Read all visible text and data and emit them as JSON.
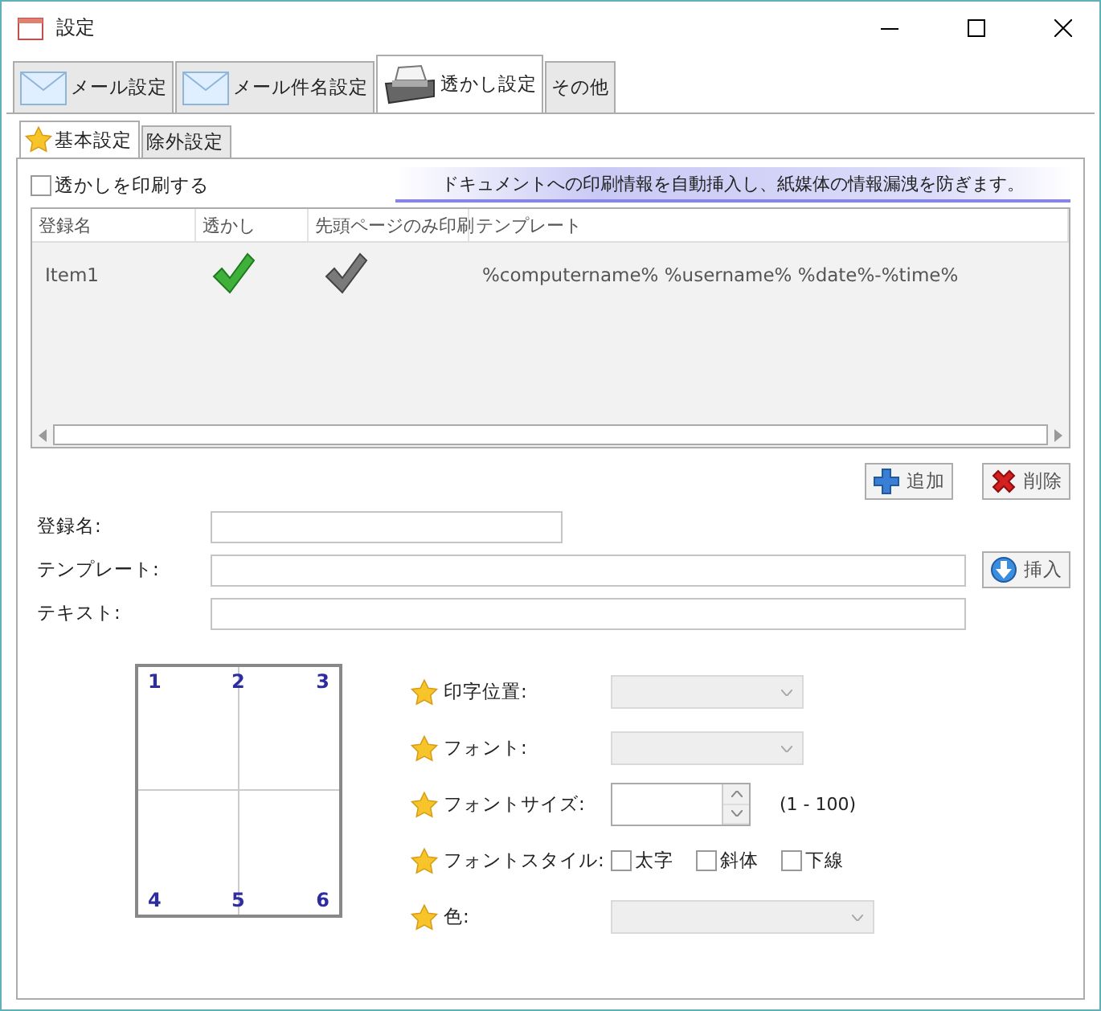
{
  "window": {
    "title": "設定"
  },
  "main_tabs": [
    {
      "label": "メール設定",
      "selected": false
    },
    {
      "label": "メール件名設定",
      "selected": false
    },
    {
      "label": "透かし設定",
      "selected": true
    },
    {
      "label": "その他",
      "selected": false
    }
  ],
  "sub_tabs": [
    {
      "label": "基本設定",
      "selected": true
    },
    {
      "label": "除外設定",
      "selected": false
    }
  ],
  "print_watermark": {
    "label": "透かしを印刷する",
    "checked": false
  },
  "banner": "ドキュメントへの印刷情報を自動挿入し、紙媒体の情報漏洩を防ぎます。",
  "table": {
    "columns": [
      "登録名",
      "透かし",
      "先頭ページのみ印刷",
      "テンプレート"
    ],
    "rows": [
      {
        "name": "Item1",
        "watermark": true,
        "first_page_only": false,
        "template": "%computername% %username% %date%-%time%"
      }
    ]
  },
  "list_buttons": [
    "追加",
    "削除"
  ],
  "fields": [
    {
      "label": "登録名:"
    },
    {
      "label": "テンプレート:",
      "button": "挿入"
    },
    {
      "label": "テキスト:"
    }
  ],
  "preview": {
    "positions": [
      "1",
      "2",
      "3",
      "4",
      "5",
      "6"
    ]
  },
  "options": [
    {
      "kind": "select",
      "label": "印字位置:"
    },
    {
      "kind": "select",
      "label": "フォント:"
    },
    {
      "kind": "spin",
      "label": "フォントサイズ:",
      "hint": "(1 - 100)"
    },
    {
      "kind": "checks",
      "label": "フォントスタイル:",
      "items": [
        {
          "label": "太字",
          "checked": false
        },
        {
          "label": "斜体",
          "checked": false
        },
        {
          "label": "下線",
          "checked": false
        }
      ]
    },
    {
      "kind": "select",
      "label": "色:"
    }
  ]
}
